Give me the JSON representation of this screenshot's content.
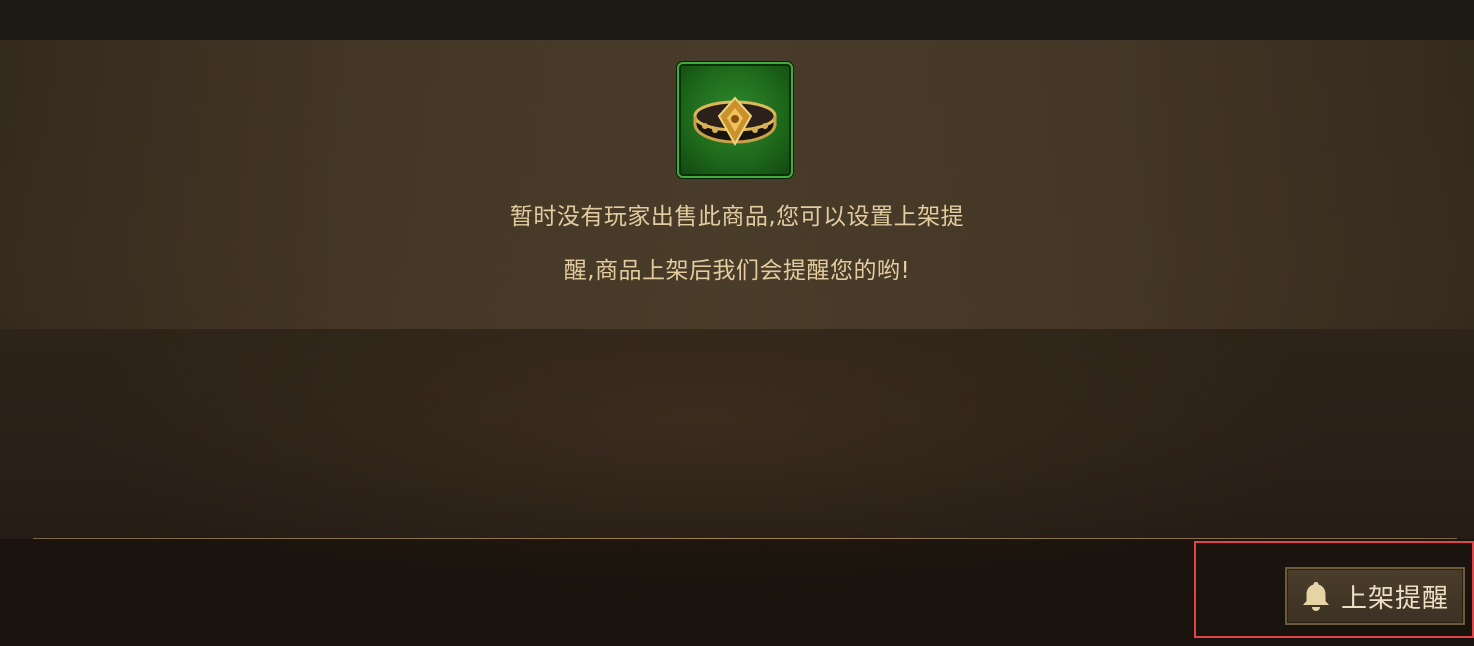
{
  "notice": {
    "line1": "暂时没有玩家出售此商品,您可以设置上架提",
    "line2": "醒,商品上架后我们会提醒您的哟!"
  },
  "item": {
    "icon": "belt-icon",
    "rarity_color": "#3fae3a"
  },
  "action": {
    "remind_label": "上架提醒",
    "icon": "bell-icon"
  },
  "colors": {
    "text": "#e2cc9f",
    "highlight": "#e0454c",
    "divider": "#9a8154"
  }
}
